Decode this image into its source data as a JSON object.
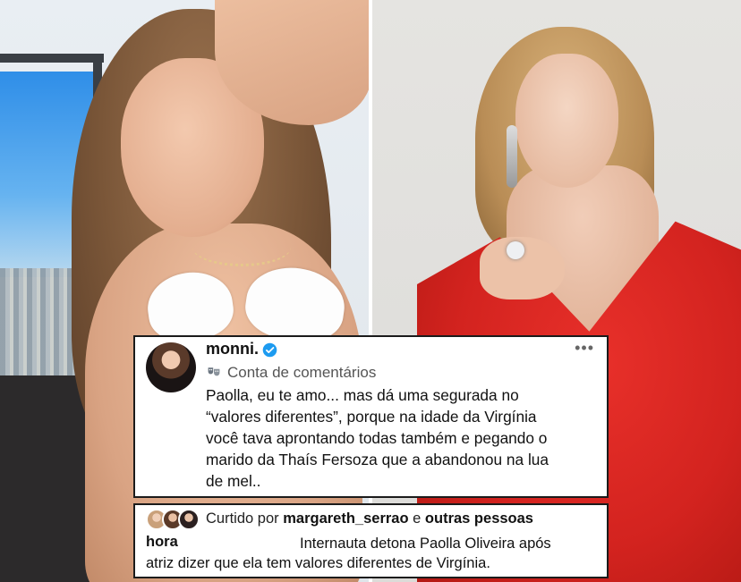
{
  "post": {
    "username": "monni.",
    "subtitle": "Conta de comentários",
    "comment_lines": [
      "Paolla, eu te amo... mas dá uma segurada no",
      "“valores diferentes”, porque na idade da Virgínia",
      "você tava aprontando todas também e pegando o",
      "marido da Thaís Fersoza que a abandonou na lua",
      "de mel.."
    ],
    "more_icon": "more-horizontal-icon",
    "verified_icon": "verified-badge-icon",
    "subtitle_icon": "masks-icon"
  },
  "likes": {
    "prefix": "Curtido por",
    "user": "margareth_serrao",
    "connector": "e",
    "others": "outras pessoas"
  },
  "footer": {
    "time_label": "hora",
    "caption_line1": "Internauta detona Paolla Oliveira após",
    "caption_line2": "atriz dizer que ela tem valores diferentes de Virgínia."
  },
  "colors": {
    "verified": "#1d9bf0",
    "dress": "#d3231f",
    "card_border": "#1b1b1b"
  }
}
